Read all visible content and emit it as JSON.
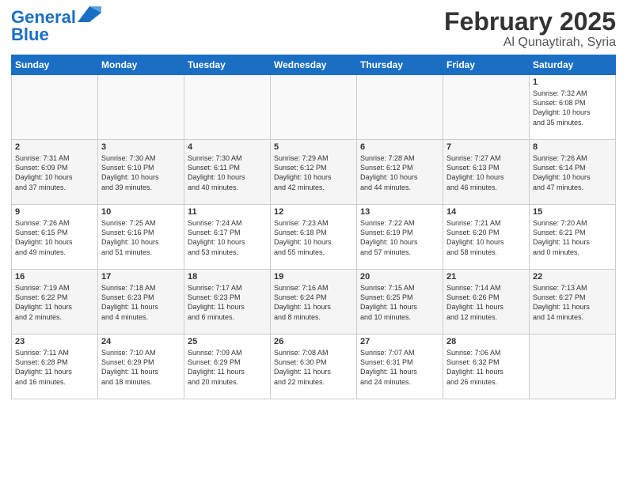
{
  "logo": {
    "line1": "General",
    "line2": "Blue"
  },
  "title": "February 2025",
  "subtitle": "Al Qunaytirah, Syria",
  "weekdays": [
    "Sunday",
    "Monday",
    "Tuesday",
    "Wednesday",
    "Thursday",
    "Friday",
    "Saturday"
  ],
  "weeks": [
    [
      {
        "day": "",
        "info": ""
      },
      {
        "day": "",
        "info": ""
      },
      {
        "day": "",
        "info": ""
      },
      {
        "day": "",
        "info": ""
      },
      {
        "day": "",
        "info": ""
      },
      {
        "day": "",
        "info": ""
      },
      {
        "day": "1",
        "info": "Sunrise: 7:32 AM\nSunset: 6:08 PM\nDaylight: 10 hours\nand 35 minutes."
      }
    ],
    [
      {
        "day": "2",
        "info": "Sunrise: 7:31 AM\nSunset: 6:09 PM\nDaylight: 10 hours\nand 37 minutes."
      },
      {
        "day": "3",
        "info": "Sunrise: 7:30 AM\nSunset: 6:10 PM\nDaylight: 10 hours\nand 39 minutes."
      },
      {
        "day": "4",
        "info": "Sunrise: 7:30 AM\nSunset: 6:11 PM\nDaylight: 10 hours\nand 40 minutes."
      },
      {
        "day": "5",
        "info": "Sunrise: 7:29 AM\nSunset: 6:12 PM\nDaylight: 10 hours\nand 42 minutes."
      },
      {
        "day": "6",
        "info": "Sunrise: 7:28 AM\nSunset: 6:12 PM\nDaylight: 10 hours\nand 44 minutes."
      },
      {
        "day": "7",
        "info": "Sunrise: 7:27 AM\nSunset: 6:13 PM\nDaylight: 10 hours\nand 46 minutes."
      },
      {
        "day": "8",
        "info": "Sunrise: 7:26 AM\nSunset: 6:14 PM\nDaylight: 10 hours\nand 47 minutes."
      }
    ],
    [
      {
        "day": "9",
        "info": "Sunrise: 7:26 AM\nSunset: 6:15 PM\nDaylight: 10 hours\nand 49 minutes."
      },
      {
        "day": "10",
        "info": "Sunrise: 7:25 AM\nSunset: 6:16 PM\nDaylight: 10 hours\nand 51 minutes."
      },
      {
        "day": "11",
        "info": "Sunrise: 7:24 AM\nSunset: 6:17 PM\nDaylight: 10 hours\nand 53 minutes."
      },
      {
        "day": "12",
        "info": "Sunrise: 7:23 AM\nSunset: 6:18 PM\nDaylight: 10 hours\nand 55 minutes."
      },
      {
        "day": "13",
        "info": "Sunrise: 7:22 AM\nSunset: 6:19 PM\nDaylight: 10 hours\nand 57 minutes."
      },
      {
        "day": "14",
        "info": "Sunrise: 7:21 AM\nSunset: 6:20 PM\nDaylight: 10 hours\nand 58 minutes."
      },
      {
        "day": "15",
        "info": "Sunrise: 7:20 AM\nSunset: 6:21 PM\nDaylight: 11 hours\nand 0 minutes."
      }
    ],
    [
      {
        "day": "16",
        "info": "Sunrise: 7:19 AM\nSunset: 6:22 PM\nDaylight: 11 hours\nand 2 minutes."
      },
      {
        "day": "17",
        "info": "Sunrise: 7:18 AM\nSunset: 6:23 PM\nDaylight: 11 hours\nand 4 minutes."
      },
      {
        "day": "18",
        "info": "Sunrise: 7:17 AM\nSunset: 6:23 PM\nDaylight: 11 hours\nand 6 minutes."
      },
      {
        "day": "19",
        "info": "Sunrise: 7:16 AM\nSunset: 6:24 PM\nDaylight: 11 hours\nand 8 minutes."
      },
      {
        "day": "20",
        "info": "Sunrise: 7:15 AM\nSunset: 6:25 PM\nDaylight: 11 hours\nand 10 minutes."
      },
      {
        "day": "21",
        "info": "Sunrise: 7:14 AM\nSunset: 6:26 PM\nDaylight: 11 hours\nand 12 minutes."
      },
      {
        "day": "22",
        "info": "Sunrise: 7:13 AM\nSunset: 6:27 PM\nDaylight: 11 hours\nand 14 minutes."
      }
    ],
    [
      {
        "day": "23",
        "info": "Sunrise: 7:11 AM\nSunset: 6:28 PM\nDaylight: 11 hours\nand 16 minutes."
      },
      {
        "day": "24",
        "info": "Sunrise: 7:10 AM\nSunset: 6:29 PM\nDaylight: 11 hours\nand 18 minutes."
      },
      {
        "day": "25",
        "info": "Sunrise: 7:09 AM\nSunset: 6:29 PM\nDaylight: 11 hours\nand 20 minutes."
      },
      {
        "day": "26",
        "info": "Sunrise: 7:08 AM\nSunset: 6:30 PM\nDaylight: 11 hours\nand 22 minutes."
      },
      {
        "day": "27",
        "info": "Sunrise: 7:07 AM\nSunset: 6:31 PM\nDaylight: 11 hours\nand 24 minutes."
      },
      {
        "day": "28",
        "info": "Sunrise: 7:06 AM\nSunset: 6:32 PM\nDaylight: 11 hours\nand 26 minutes."
      },
      {
        "day": "",
        "info": ""
      }
    ]
  ]
}
